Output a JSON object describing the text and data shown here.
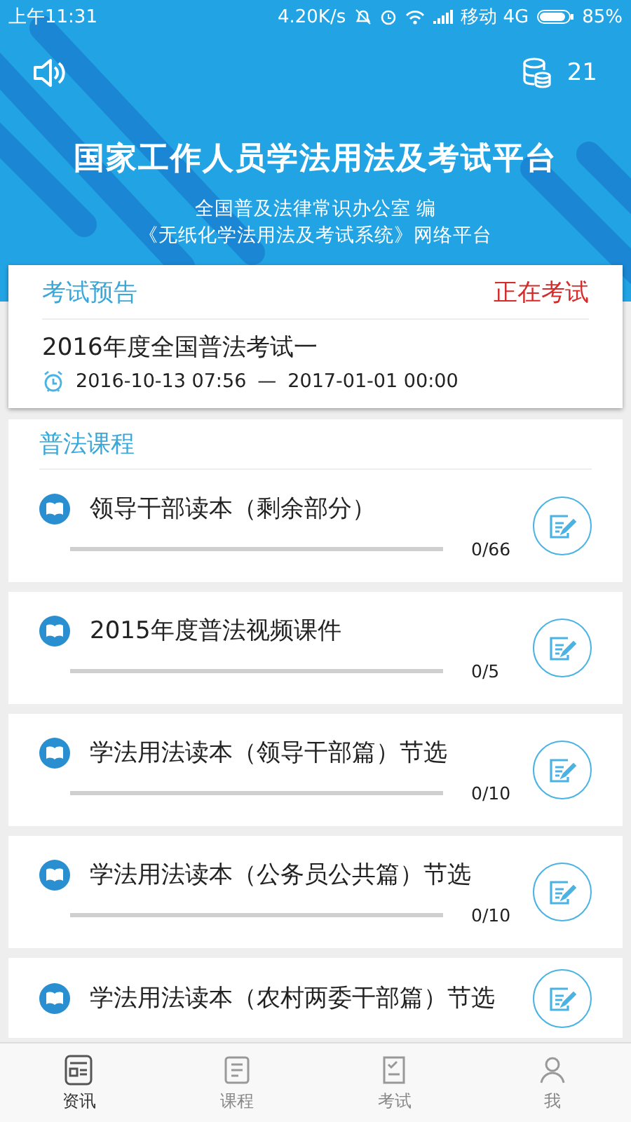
{
  "status_bar": {
    "time": "上午11:31",
    "speed": "4.20K/s",
    "carrier": "移动 4G",
    "battery": "85%"
  },
  "header": {
    "coins": "21",
    "title": "国家工作人员学法用法及考试平台",
    "subtitle_1": "全国普及法律常识办公室 编",
    "subtitle_2": "《无纸化学法用法及考试系统》网络平台"
  },
  "exam": {
    "heading": "考试预告",
    "status": "正在考试",
    "name": "2016年度全国普法考试一",
    "start": "2016-10-13 07:56",
    "separator": "—",
    "end": "2017-01-01 00:00"
  },
  "courses": {
    "heading": "普法课程",
    "items": [
      {
        "title": "领导干部读本（剩余部分）",
        "level": 0,
        "progress": "0/66"
      },
      {
        "title": "2015年度普法视频课件",
        "level": 0,
        "progress": "0/5"
      },
      {
        "title": "学法用法读本（领导干部篇）节选",
        "level": 0,
        "progress": "0/10"
      },
      {
        "title": "学法用法读本（公务员公共篇）节选",
        "level": 0,
        "progress": "0/10"
      },
      {
        "title": "学法用法读本（农村两委干部篇）节选"
      }
    ]
  },
  "tabs": [
    {
      "label": "资讯",
      "selected": true
    },
    {
      "label": "课程",
      "selected": false
    },
    {
      "label": "考试",
      "selected": false
    },
    {
      "label": "我",
      "selected": false
    }
  ]
}
